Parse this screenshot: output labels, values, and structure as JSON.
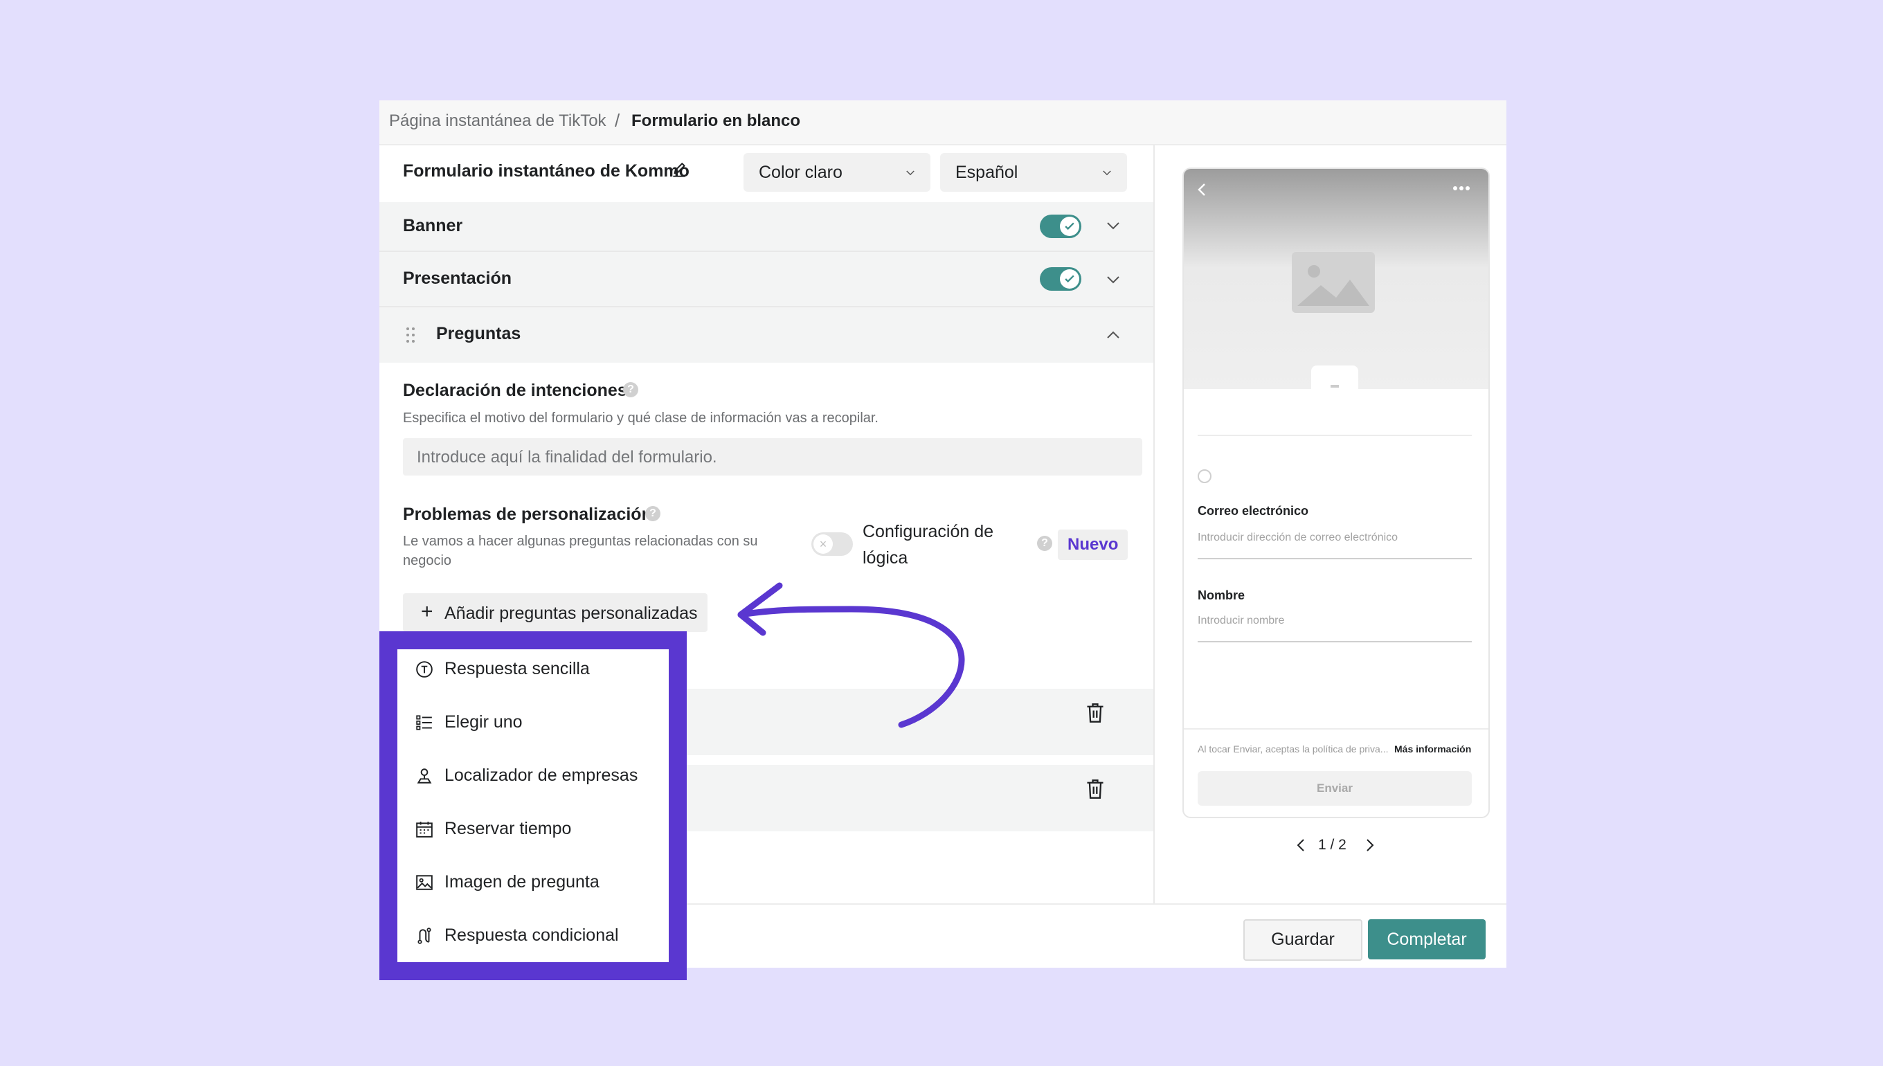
{
  "breadcrumb": {
    "parent": "Página instantánea de TikTok",
    "separator": "/",
    "current": "Formulario en blanco"
  },
  "form_header": {
    "title": "Formulario instantáneo de Kommo",
    "theme_select": "Color claro",
    "language_select": "Español"
  },
  "sections": {
    "banner": "Banner",
    "presentacion": "Presentación",
    "preguntas": "Preguntas"
  },
  "intent": {
    "label": "Declaración de intenciones",
    "description": "Especifica el motivo del formulario y qué clase de información vas a recopilar.",
    "placeholder": "Introduce aquí la finalidad del formulario."
  },
  "custom": {
    "label": "Problemas de personalización",
    "description": "Le vamos a hacer algunas preguntas relacionadas con su negocio",
    "logic_label": "Configuración de lógica",
    "badge": "Nuevo",
    "add_button": "Añadir preguntas personalizadas"
  },
  "menu": {
    "items": [
      {
        "label": "Respuesta sencilla",
        "icon": "text-circle-icon"
      },
      {
        "label": "Elegir uno",
        "icon": "list-icon"
      },
      {
        "label": "Localizador de empresas",
        "icon": "location-pin-icon"
      },
      {
        "label": "Reservar tiempo",
        "icon": "calendar-icon"
      },
      {
        "label": "Imagen de pregunta",
        "icon": "image-icon"
      },
      {
        "label": "Respuesta condicional",
        "icon": "branch-icon"
      }
    ]
  },
  "preview": {
    "email_label": "Correo electrónico",
    "email_placeholder": "Introducir dirección de correo electrónico",
    "name_label": "Nombre",
    "name_placeholder": "Introducir nombre",
    "disclaimer": "Al tocar Enviar, aceptas la política de priva...",
    "more_info": "Más información",
    "submit": "Enviar",
    "pager": "1 / 2"
  },
  "footer": {
    "save": "Guardar",
    "complete": "Completar"
  },
  "colors": {
    "background": "#e3dffd",
    "accent_purple": "#5a37d0",
    "teal": "#3d8f8b"
  }
}
